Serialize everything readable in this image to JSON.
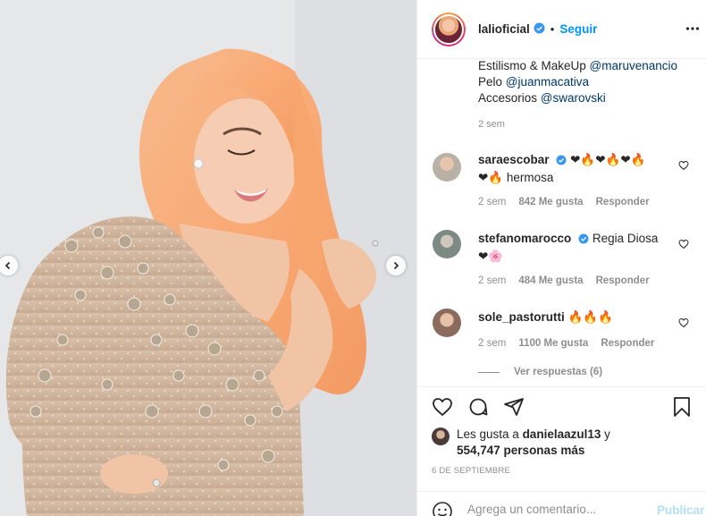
{
  "post": {
    "username": "lalioficial",
    "follow_label": "Seguir",
    "separator": "•",
    "caption": {
      "line1_prefix": "Estilismo & MakeUp ",
      "line1_mention": "@maruvenancio",
      "line2_prefix": "Pelo ",
      "line2_mention": "@juanmacativa",
      "line3_prefix": "Accesorios ",
      "line3_mention": "@swarovski",
      "time": "2 sem"
    },
    "comments": [
      {
        "username": "saraescobar",
        "text": "❤🔥❤🔥❤🔥",
        "text2": "❤🔥 hermosa",
        "time": "2 sem",
        "likes": "842 Me gusta",
        "reply": "Responder"
      },
      {
        "username": "stefanomarocco",
        "text": "Regia Diosa",
        "text2": "❤🌸",
        "time": "2 sem",
        "likes": "484 Me gusta",
        "reply": "Responder"
      },
      {
        "username": "sole_pastorutti",
        "text": "🔥🔥🔥",
        "time": "2 sem",
        "likes": "1100 Me gusta",
        "reply": "Responder",
        "view_replies": "Ver respuestas (6)"
      }
    ],
    "likes_prefix": "Les gusta a ",
    "likes_user": "danielaazul13",
    "likes_and": " y",
    "likes_count": "554,747 personas más",
    "date": "6 DE SEPTIEMBRE",
    "comment_placeholder": "Agrega un comentario...",
    "publish_label": "Publicar",
    "icons": {
      "verified": "verified-badge-icon",
      "more": "more-options-icon",
      "like": "heart-icon",
      "comment": "comment-icon",
      "share": "share-icon",
      "save": "bookmark-icon",
      "emoji": "emoji-icon",
      "prev": "chevron-left-icon",
      "next": "chevron-right-icon"
    },
    "colors": {
      "accent": "#0095f6",
      "verified": "#3897f0",
      "publish_disabled": "#b2dffc",
      "muted": "#8e8e8e"
    }
  }
}
